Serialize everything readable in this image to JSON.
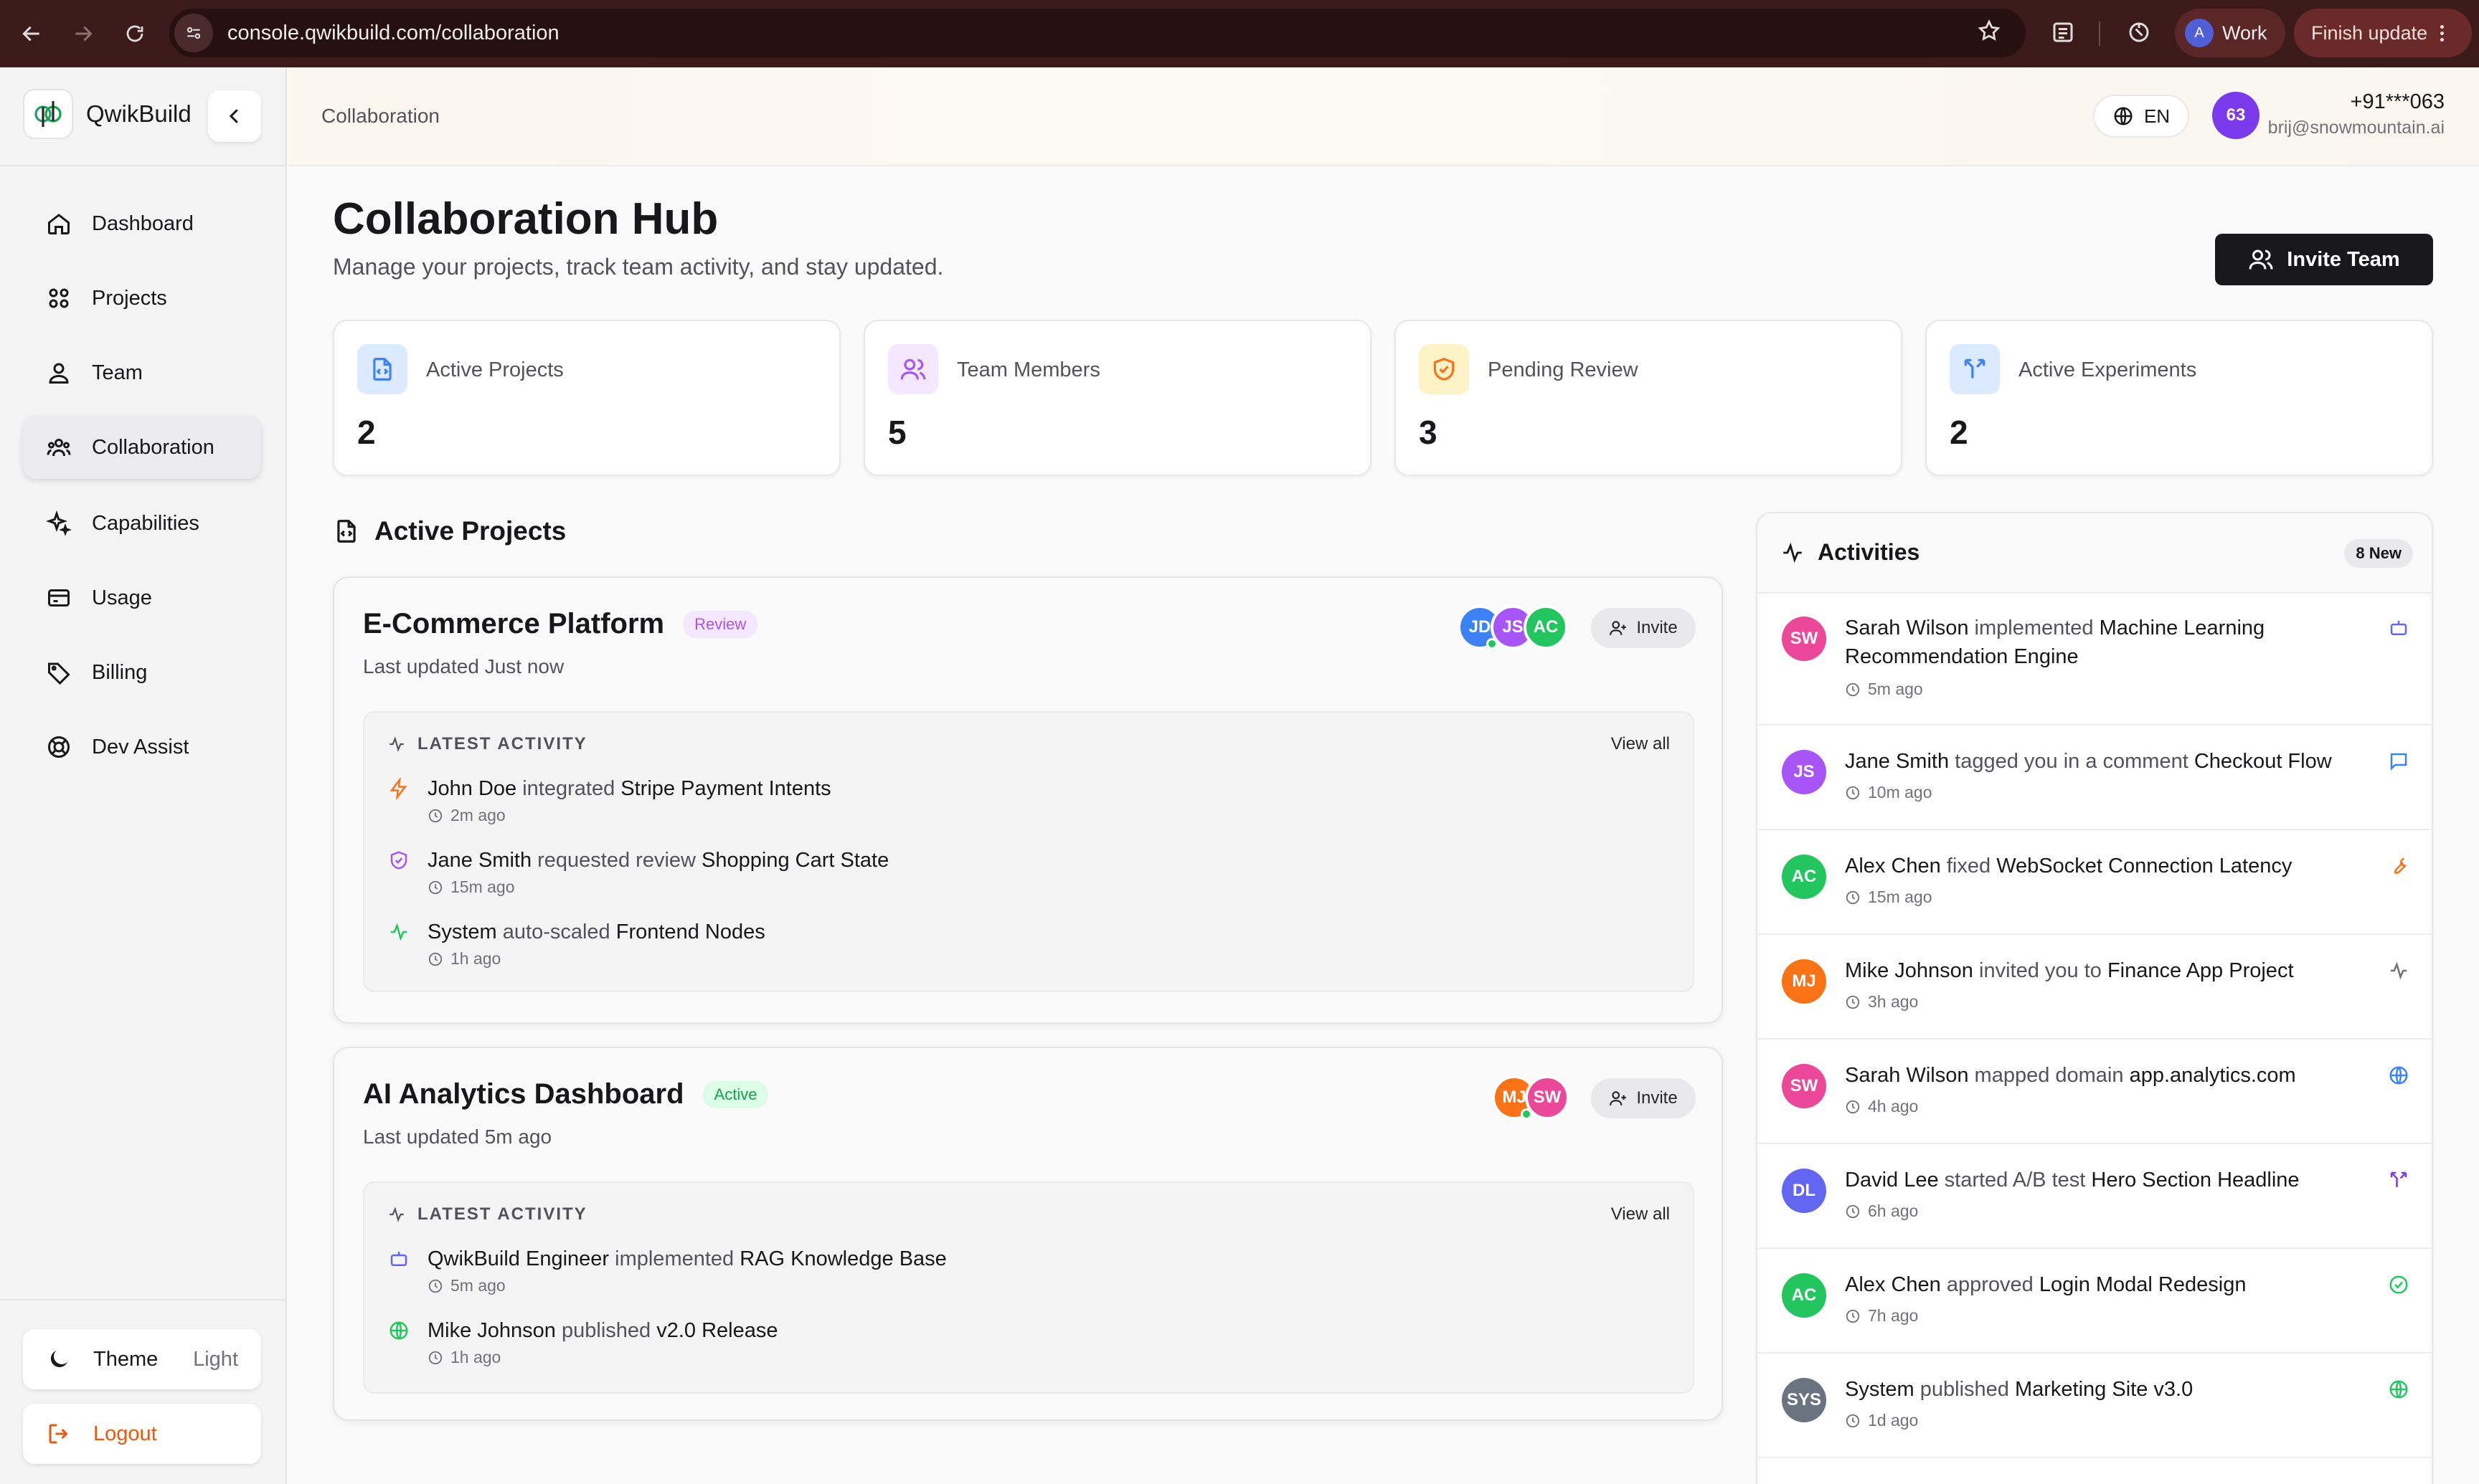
{
  "browser": {
    "url": "console.qwikbuild.com/collaboration",
    "profile_initial": "A",
    "profile_label": "Work",
    "finish_update": "Finish update"
  },
  "sidebar": {
    "brand": "QwikBuild",
    "items": [
      {
        "label": "Dashboard",
        "icon": "home-icon"
      },
      {
        "label": "Projects",
        "icon": "grid-icon"
      },
      {
        "label": "Team",
        "icon": "users-icon"
      },
      {
        "label": "Collaboration",
        "icon": "people-group-icon",
        "active": true
      },
      {
        "label": "Capabilities",
        "icon": "sparkles-icon"
      },
      {
        "label": "Usage",
        "icon": "card-icon"
      },
      {
        "label": "Billing",
        "icon": "tag-icon"
      },
      {
        "label": "Dev Assist",
        "icon": "lifebuoy-icon"
      }
    ],
    "theme_label": "Theme",
    "theme_value": "Light",
    "logout": "Logout"
  },
  "topbar": {
    "breadcrumb": "Collaboration",
    "lang": "EN",
    "user_initials": "63",
    "user_phone": "+91***063",
    "user_email": "brij@snowmountain.ai"
  },
  "page": {
    "title": "Collaboration Hub",
    "subtitle": "Manage your projects, track team activity, and stay updated.",
    "invite_team": "Invite Team"
  },
  "stats": [
    {
      "label": "Active Projects",
      "value": "2",
      "color": "#3b82f6"
    },
    {
      "label": "Team Members",
      "value": "5",
      "color": "#a855f7"
    },
    {
      "label": "Pending Review",
      "value": "3",
      "color": "#f59e0b"
    },
    {
      "label": "Active Experiments",
      "value": "2",
      "color": "#3b82f6"
    }
  ],
  "projects_section": {
    "title": "Active Projects",
    "latest_activity": "LATEST ACTIVITY",
    "view_all": "View all",
    "invite": "Invite"
  },
  "projects": [
    {
      "name": "E-Commerce Platform",
      "status": "Review",
      "updated": "Last updated Just now",
      "members": [
        "JD",
        "JS",
        "AC"
      ],
      "activity": [
        {
          "actor": "John Doe",
          "verb": "integrated",
          "target": "Stripe Payment Intents",
          "time": "2m ago",
          "icon": "lightning-icon"
        },
        {
          "actor": "Jane Smith",
          "verb": "requested review",
          "target": "Shopping Cart State",
          "time": "15m ago",
          "icon": "shield-icon"
        },
        {
          "actor": "System",
          "verb": "auto-scaled",
          "target": "Frontend Nodes",
          "time": "1h ago",
          "icon": "pulse-icon"
        }
      ]
    },
    {
      "name": "AI Analytics Dashboard",
      "status": "Active",
      "updated": "Last updated 5m ago",
      "members": [
        "MJ",
        "SW"
      ],
      "activity": [
        {
          "actor": "QwikBuild Engineer",
          "verb": "implemented",
          "target": "RAG Knowledge Base",
          "time": "5m ago",
          "icon": "robot-icon"
        },
        {
          "actor": "Mike Johnson",
          "verb": "published",
          "target": "v2.0 Release",
          "time": "1h ago",
          "icon": "globe-icon"
        }
      ]
    }
  ],
  "activities": {
    "title": "Activities",
    "badge": "8 New",
    "items": [
      {
        "initials": "SW",
        "color": "#ec4899",
        "actor": "Sarah Wilson",
        "verb": "implemented",
        "target": "Machine Learning Recommendation Engine",
        "time": "5m ago",
        "icon": "robot-icon",
        "icon_color": "#6366f1"
      },
      {
        "initials": "JS",
        "color": "#a855f7",
        "actor": "Jane Smith",
        "verb": "tagged you in a comment",
        "target": "Checkout Flow",
        "time": "10m ago",
        "icon": "comment-icon",
        "icon_color": "#3b82f6"
      },
      {
        "initials": "AC",
        "color": "#22c55e",
        "actor": "Alex Chen",
        "verb": "fixed",
        "target": "WebSocket Connection Latency",
        "time": "15m ago",
        "icon": "wrench-icon",
        "icon_color": "#f97316"
      },
      {
        "initials": "MJ",
        "color": "#f97316",
        "actor": "Mike Johnson",
        "verb": "invited you to",
        "target": "Finance App Project",
        "time": "3h ago",
        "icon": "pulse-icon",
        "icon_color": "#71717a"
      },
      {
        "initials": "SW",
        "color": "#ec4899",
        "actor": "Sarah Wilson",
        "verb": "mapped domain",
        "target": "app.analytics.com",
        "time": "4h ago",
        "icon": "globe-icon",
        "icon_color": "#3b82f6"
      },
      {
        "initials": "DL",
        "color": "#6366f1",
        "actor": "David Lee",
        "verb": "started A/B test",
        "target": "Hero Section Headline",
        "time": "6h ago",
        "icon": "split-icon",
        "icon_color": "#7c3aed"
      },
      {
        "initials": "AC",
        "color": "#22c55e",
        "actor": "Alex Chen",
        "verb": "approved",
        "target": "Login Modal Redesign",
        "time": "7h ago",
        "icon": "check-circle-icon",
        "icon_color": "#22c55e"
      },
      {
        "initials": "SYS",
        "color": "#6b7280",
        "actor": "System",
        "verb": "published",
        "target": "Marketing Site v3.0",
        "time": "1d ago",
        "icon": "globe-icon",
        "icon_color": "#22c55e"
      }
    ]
  }
}
